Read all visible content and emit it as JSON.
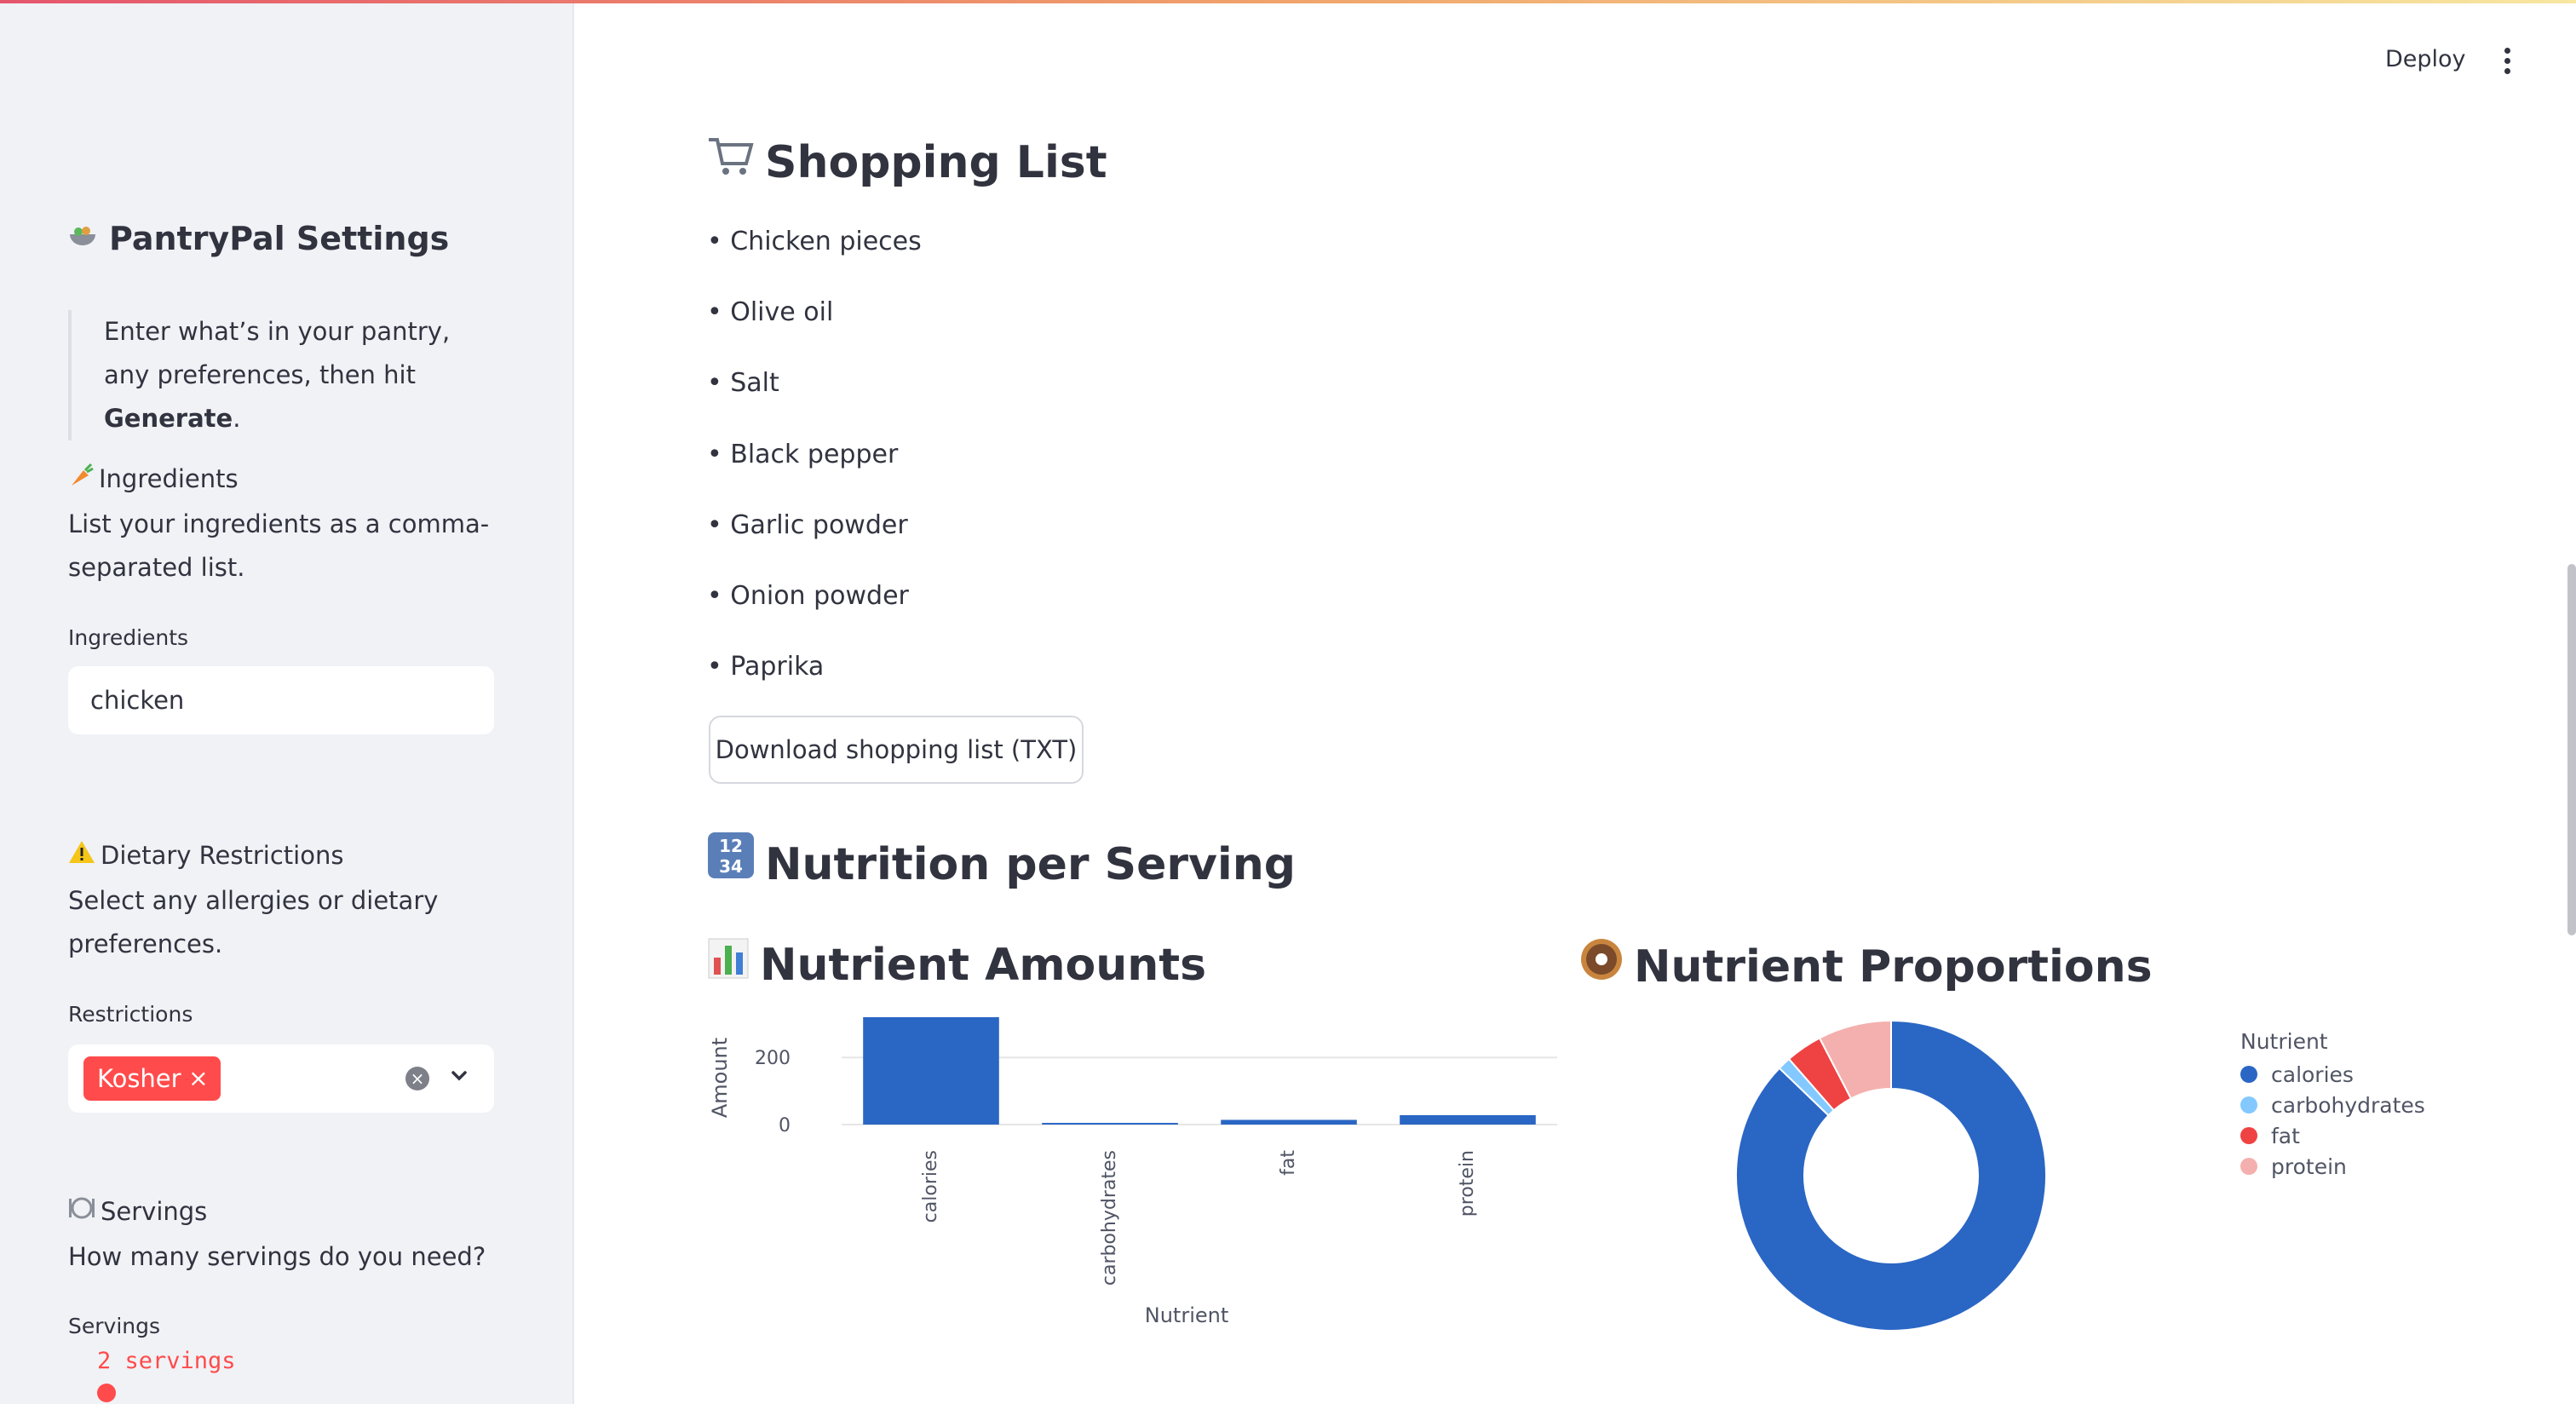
{
  "header": {
    "deploy_label": "Deploy"
  },
  "sidebar": {
    "title": "PantryPal Settings",
    "intro_prefix": "Enter what’s in your pantry, any preferences, then hit ",
    "intro_bold": "Generate",
    "intro_suffix": ".",
    "ingredients": {
      "title": "Ingredients",
      "description": "List your ingredients as a comma-separated list.",
      "field_label": "Ingredients",
      "value": "chicken"
    },
    "dietary": {
      "title": "Dietary Restrictions",
      "description": "Select any allergies or dietary preferences.",
      "field_label": "Restrictions",
      "selected": "Kosher"
    },
    "servings": {
      "title": "Servings",
      "description": "How many servings do you need?",
      "field_label": "Servings",
      "value": "2 servings"
    }
  },
  "shopping": {
    "title": "Shopping List",
    "items": [
      "• Chicken pieces",
      "• Olive oil",
      "• Salt",
      "• Black pepper",
      "• Garlic powder",
      "• Onion powder",
      "• Paprika"
    ],
    "download_label": "Download shopping list (TXT)"
  },
  "nutrition": {
    "title": "Nutrition per Serving",
    "amounts_title": "Nutrient Amounts",
    "proportions_title": "Nutrient Proportions",
    "legend_title": "Nutrient"
  },
  "colors": {
    "accent": "#ff4b4b",
    "calories": "#2a66c4",
    "carbohydrates": "#83c9ff",
    "fat": "#ef4242",
    "protein": "#f4b0ae"
  },
  "chart_data": [
    {
      "type": "bar",
      "categories": [
        "calories",
        "carbohydrates",
        "fat",
        "protein"
      ],
      "values": [
        320,
        5,
        14,
        28
      ],
      "xlabel": "Nutrient",
      "ylabel": "Amount",
      "yticks": [
        0,
        200
      ],
      "ylim": [
        0,
        330
      ],
      "grid": true
    },
    {
      "type": "pie",
      "hole": true,
      "labels": [
        "calories",
        "carbohydrates",
        "fat",
        "protein"
      ],
      "values": [
        320,
        5,
        14,
        28
      ],
      "legend_title": "Nutrient",
      "legend_position": "right"
    }
  ]
}
